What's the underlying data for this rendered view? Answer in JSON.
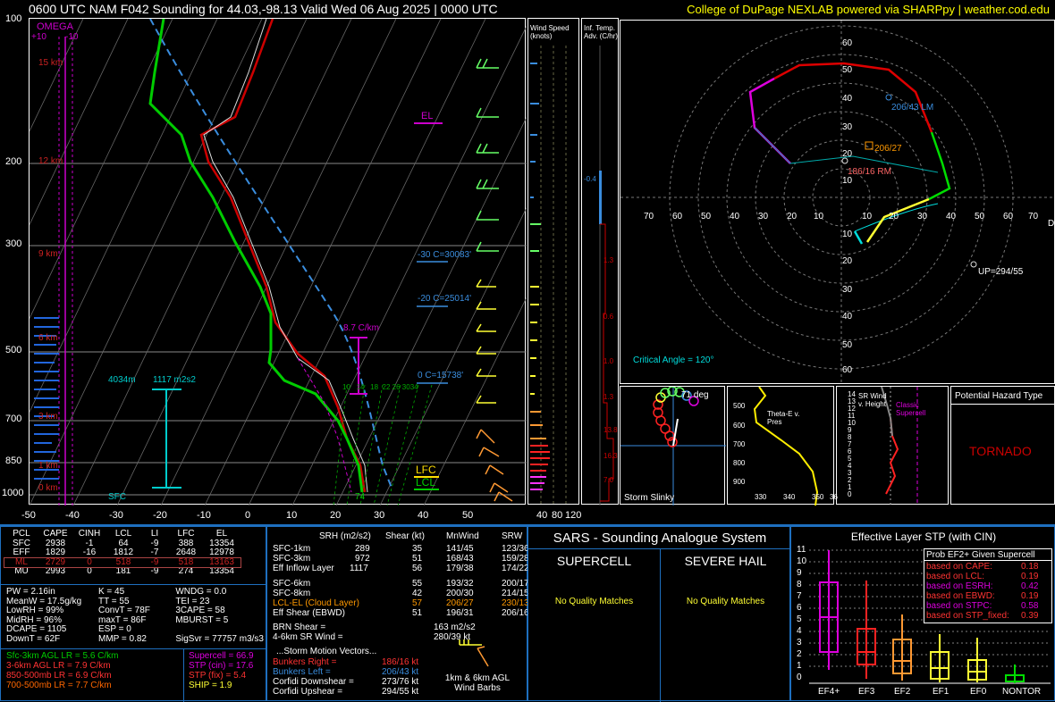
{
  "header": {
    "title": "0600 UTC NAM F042 Sounding for 44.03,-98.13 Valid  Wed 06 Aug 2025 | 0000 UTC",
    "credit": "College of DuPage NEXLAB powered via SHARPpy | weather.cod.edu"
  },
  "skewt": {
    "pressure_labels": [
      "100",
      "200",
      "300",
      "500",
      "700",
      "850",
      "1000"
    ],
    "temp_labels": [
      "-50",
      "-40",
      "-30",
      "-20",
      "-10",
      "0",
      "10",
      "20",
      "30",
      "40",
      "50"
    ],
    "height_labels": [
      "15 km",
      "12 km",
      "9 km",
      "6 km",
      "3 km",
      "1 km",
      "0 km"
    ],
    "omega_label": "OMEGA",
    "omega_ticks": [
      "+10",
      "-10"
    ],
    "el_label": "EL",
    "lfc_label": "LFC",
    "lcl_label": "LCL",
    "sfc_label": "SFC",
    "frz_labels": [
      "-30 C=30083'",
      "-20 C=25014'",
      "0 C=15738'"
    ],
    "lapse_label": "8.7 C/km",
    "inflow_depth": "4034m",
    "inflow_srh": "1117 m2s2",
    "sfc_temp": "74",
    "wetbulb_ticks": [
      "10",
      "14",
      "18",
      "22",
      "26",
      "30",
      "34"
    ]
  },
  "wind_speed": {
    "title": "Wind Speed (knots)",
    "ticks": [
      "40",
      "80",
      "120"
    ]
  },
  "temp_adv": {
    "title": "Inf. Temp. Adv. (C/hr)",
    "values": [
      "-0.4",
      "1.3",
      "0.6",
      "1.0",
      "1.3",
      "13.8",
      "16.3",
      "7.0"
    ]
  },
  "hodograph": {
    "rings": [
      "10",
      "20",
      "30",
      "40",
      "50",
      "60"
    ],
    "x_labels": [
      "70",
      "60",
      "50",
      "40",
      "30",
      "20",
      "10",
      "10",
      "20",
      "30",
      "40",
      "50",
      "60",
      "70"
    ],
    "lm_label": "206/43 LM",
    "mean_label": "206/27",
    "rm_label": "186/16 RM",
    "up_label": "UP=294/55",
    "critical_angle": "Critical Angle = 120°",
    "d_label": "D"
  },
  "slinky": {
    "label": "Storm Slinky",
    "angle": "71 deg"
  },
  "theta": {
    "label": "Theta-E v. Pres",
    "x": [
      "330",
      "340",
      "350",
      "36"
    ],
    "p": [
      "500",
      "600",
      "700",
      "800",
      "900",
      "1000"
    ]
  },
  "srwind": {
    "label": "SR Wind v. Height",
    "classic": "Classic Supercell",
    "y": [
      "14",
      "12",
      "10",
      "8",
      "6",
      "4",
      "2",
      "0"
    ],
    "y2": [
      "13",
      "11",
      "9",
      "7",
      "5",
      "3",
      "1"
    ]
  },
  "hazard": {
    "title": "Potential Hazard Type",
    "value": "TORNADO"
  },
  "parcels": {
    "headers": [
      "PCL",
      "CAPE",
      "CINH",
      "LCL",
      "LI",
      "LFC",
      "EL"
    ],
    "rows": [
      [
        "SFC",
        "2938",
        "-1",
        "64",
        "-9",
        "388",
        "13354"
      ],
      [
        "EFF",
        "1829",
        "-16",
        "1812",
        "-7",
        "2648",
        "12978"
      ],
      [
        "ML",
        "2729",
        "0",
        "518",
        "-9",
        "518",
        "13163"
      ],
      [
        "MU",
        "2993",
        "0",
        "181",
        "-9",
        "274",
        "13354"
      ]
    ]
  },
  "indices": {
    "rows": [
      [
        "PW = 2.16in",
        "K = 45",
        "WNDG = 0.0"
      ],
      [
        "MeanW = 17.5g/kg",
        "TT = 55",
        "TEI = 23"
      ],
      [
        "LowRH = 99%",
        "ConvT = 78F",
        "3CAPE = 58"
      ],
      [
        "MidRH = 96%",
        "maxT = 86F",
        "MBURST = 5"
      ],
      [
        "DCAPE = 1105",
        "ESP = 0",
        ""
      ],
      [
        "DownT = 62F",
        "MMP = 0.82",
        "SigSvr = 77757 m3/s3"
      ]
    ]
  },
  "lapse": [
    "Sfc-3km AGL LR = 5.6 C/km",
    "3-6km AGL LR = 7.9 C/km",
    "850-500mb LR = 6.9 C/km",
    "700-500mb LR = 7.7 C/km"
  ],
  "composite": [
    "Supercell = 66.9",
    "STP (cin) = 17.6",
    "STP (fix) = 5.4",
    "SHIP = 1.9"
  ],
  "kinematics": {
    "headers": [
      "SRH (m2/s2)",
      "Shear (kt)",
      "MnWind",
      "SRW"
    ],
    "rows": [
      [
        "SFC-1km",
        "289",
        "35",
        "141/45",
        "123/36"
      ],
      [
        "SFC-3km",
        "972",
        "51",
        "168/43",
        "159/28"
      ],
      [
        "Eff Inflow Layer",
        "1117",
        "56",
        "179/38",
        "174/22"
      ],
      [
        "SFC-6km",
        "55",
        "193/32",
        "200/17",
        ""
      ],
      [
        "SFC-8km",
        "42",
        "200/30",
        "214/15",
        ""
      ],
      [
        "LCL-EL (Cloud Layer)",
        "57",
        "206/27",
        "230/13",
        ""
      ],
      [
        "Eff Shear (EBWD)",
        "51",
        "196/31",
        "206/16",
        ""
      ]
    ],
    "brn": "BRN Shear =",
    "brn_val": "163 m2/s2",
    "srw46": "4-6km SR Wind =",
    "srw46_val": "280/39 kt",
    "motion_title": "...Storm Motion Vectors...",
    "motion": [
      [
        "Bunkers Right =",
        "186/16 kt"
      ],
      [
        "Bunkers Left =",
        "206/43 kt"
      ],
      [
        "Corfidi Downshear =",
        "273/76 kt"
      ],
      [
        "Corfidi Upshear =",
        "294/55 kt"
      ]
    ],
    "barbs_label": "1km & 6km AGL Wind Barbs"
  },
  "sars": {
    "title": "SARS - Sounding Analogue System",
    "supercell": "SUPERCELL",
    "hail": "SEVERE HAIL",
    "none1": "No Quality Matches",
    "none2": "No Quality Matches"
  },
  "stp": {
    "title": "Effective Layer STP (with CIN)",
    "prob_title": "Prob EF2+ Given Supercell",
    "prob": [
      [
        "based on CAPE:",
        "0.18"
      ],
      [
        "based on LCL:",
        "0.19"
      ],
      [
        "based on ESRH:",
        "0.42"
      ],
      [
        "based on EBWD:",
        "0.19"
      ],
      [
        "based on STPC:",
        "0.58"
      ],
      [
        "based on STP_fixed:",
        "0.39"
      ]
    ],
    "y_ticks": [
      "0",
      "1",
      "2",
      "3",
      "4",
      "5",
      "6",
      "7",
      "8",
      "9",
      "10",
      "11"
    ],
    "categories": [
      "EF4+",
      "EF3",
      "EF2",
      "EF1",
      "EF0",
      "NONTOR"
    ]
  },
  "colors": {
    "frame": "#1e6fbf",
    "temp": "#cc0000",
    "dew": "#00cc00",
    "parcel": "#ffffff"
  }
}
